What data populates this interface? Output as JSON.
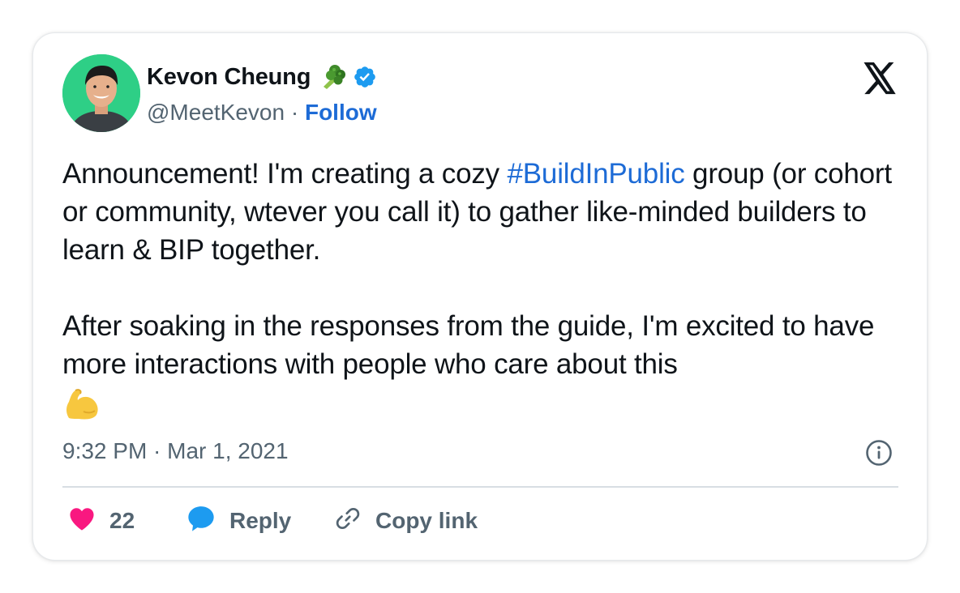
{
  "author": {
    "name": "Kevon Cheung",
    "handle": "@MeetKevon",
    "separator": "·",
    "follow_label": "Follow"
  },
  "tweet": {
    "para1_before": "Announcement! I'm creating a cozy ",
    "hashtag": "#BuildInPublic",
    "para1_after": " group (or cohort or community, wtever you call it) to gather like-minded builders to learn & BIP together.",
    "para2": "After soaking in the responses from the guide, I'm excited to have more interactions with people who care about this",
    "emoji": "flexed-biceps-emoji"
  },
  "timestamp": "9:32 PM · Mar 1, 2021",
  "actions": {
    "like_count": "22",
    "reply_label": "Reply",
    "copy_label": "Copy link"
  },
  "icons": {
    "logo": "x-logo-icon",
    "verified": "verified-badge-icon",
    "broccoli": "broccoli-icon",
    "info": "info-icon",
    "heart": "heart-icon",
    "reply": "reply-bubble-icon",
    "link": "link-icon"
  },
  "colors": {
    "link_blue": "#1d6bd6",
    "verified_blue": "#1d9bf0",
    "heart_pink": "#f91880",
    "muted_gray": "#536471"
  }
}
